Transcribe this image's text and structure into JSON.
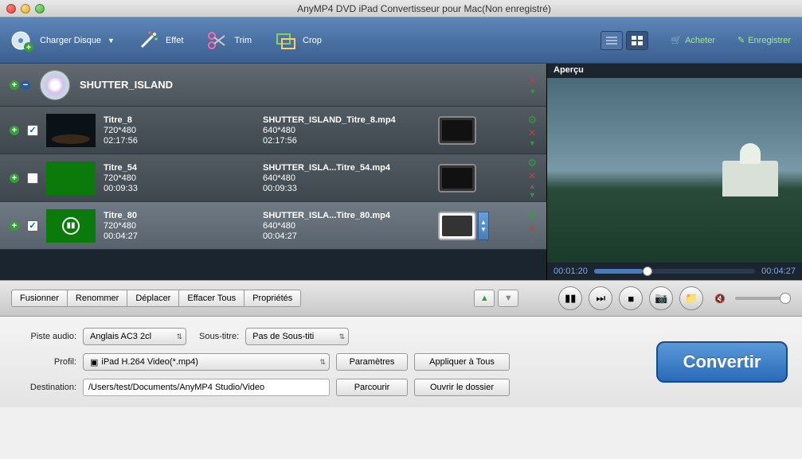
{
  "window": {
    "title": "AnyMP4 DVD iPad Convertisseur pour Mac(Non enregistré)"
  },
  "toolbar": {
    "load": "Charger Disque",
    "effect": "Effet",
    "trim": "Trim",
    "crop": "Crop",
    "buy": "Acheter",
    "register": "Enregistrer"
  },
  "disc": {
    "name": "SHUTTER_ISLAND"
  },
  "rows": [
    {
      "checked": true,
      "title": "Titre_8",
      "res": "720*480",
      "dur": "02:17:56",
      "out": "SHUTTER_ISLAND_Titre_8.mp4",
      "outres": "640*480",
      "outdur": "02:17:56",
      "thumb": "dark"
    },
    {
      "checked": false,
      "title": "Titre_54",
      "res": "720*480",
      "dur": "00:09:33",
      "out": "SHUTTER_ISLA...Titre_54.mp4",
      "outres": "640*480",
      "outdur": "00:09:33",
      "thumb": "green"
    },
    {
      "checked": true,
      "title": "Titre_80",
      "res": "720*480",
      "dur": "00:04:27",
      "out": "SHUTTER_ISLA...Titre_80.mp4",
      "outres": "640*480",
      "outdur": "00:04:27",
      "thumb": "greenplay",
      "selected": true
    }
  ],
  "preview": {
    "label": "Aperçu",
    "t1": "00:01:20",
    "t2": "00:04:27"
  },
  "listbtns": {
    "merge": "Fusionner",
    "rename": "Renommer",
    "move": "Déplacer",
    "clear": "Effacer Tous",
    "props": "Propriétés"
  },
  "form": {
    "audio_lbl": "Piste audio:",
    "audio_val": "Anglais AC3 2cl",
    "sub_lbl": "Sous-titre:",
    "sub_val": "Pas de Sous-titi",
    "profile_lbl": "Profil:",
    "profile_val": "iPad H.264 Video(*.mp4)",
    "dest_lbl": "Destination:",
    "dest_val": "/Users/test/Documents/AnyMP4 Studio/Video",
    "params": "Paramètres",
    "apply": "Appliquer à Tous",
    "browse": "Parcourir",
    "open": "Ouvrir le dossier"
  },
  "convert": "Convertir"
}
